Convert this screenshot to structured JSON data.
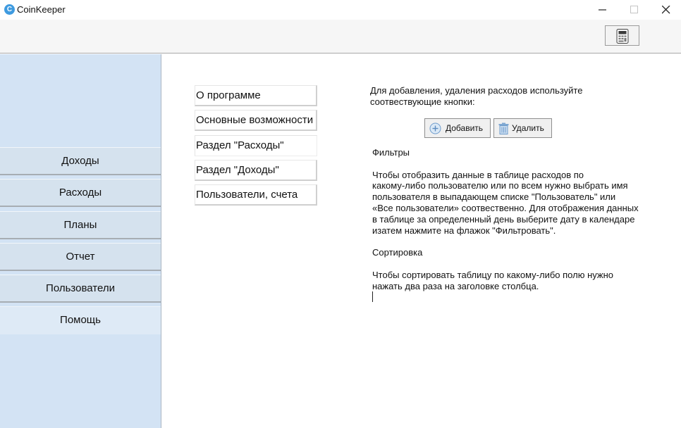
{
  "window": {
    "title": "CoinKeeper",
    "logo_letter": "C",
    "controls": [
      "minimize-icon",
      "maximize-icon",
      "close-icon"
    ]
  },
  "toolbar": {
    "calculator_icon": "calculator-icon"
  },
  "sidebar": {
    "items": [
      {
        "label": "Доходы"
      },
      {
        "label": "Расходы"
      },
      {
        "label": "Планы"
      },
      {
        "label": "Отчет"
      },
      {
        "label": "Пользователи"
      },
      {
        "label": "Помощь",
        "active": true
      }
    ]
  },
  "help": {
    "topics": [
      {
        "label": "О  программе"
      },
      {
        "label": "Основные возможности"
      },
      {
        "label": "Раздел \"Расходы\"",
        "selected": true
      },
      {
        "label": "Раздел \"Доходы\""
      },
      {
        "label": "Пользователи, счета"
      }
    ],
    "intro": "Для добавления, удаления расходов  используйте соотвествующие кнопки:",
    "add_button": "Добавить",
    "delete_button": "Удалить",
    "filters_heading": "Фильтры",
    "filters_text": "Чтобы отобразить данные в таблице расходов по\nкакому-либо пользователю  или по всем нужно выбрать имя\nпользователя в выпадающем списке \"Пользователь\"   или\n«Все пользователи» соотвественно. Для отображения данных\nв таблице за определенный день  выберите дату в календаре\nизатем  нажмите на  флажок \"Фильтровать\".",
    "sort_heading": "Сортировка",
    "sort_text": "Чтобы сортировать таблицу по какому-либо полю нужно\nнажать два раза на заголовке столбца."
  },
  "colors": {
    "sidebar": "#d3e3f4",
    "toolbar": "#f6f6f6",
    "app_icon": "#3f9be0"
  }
}
